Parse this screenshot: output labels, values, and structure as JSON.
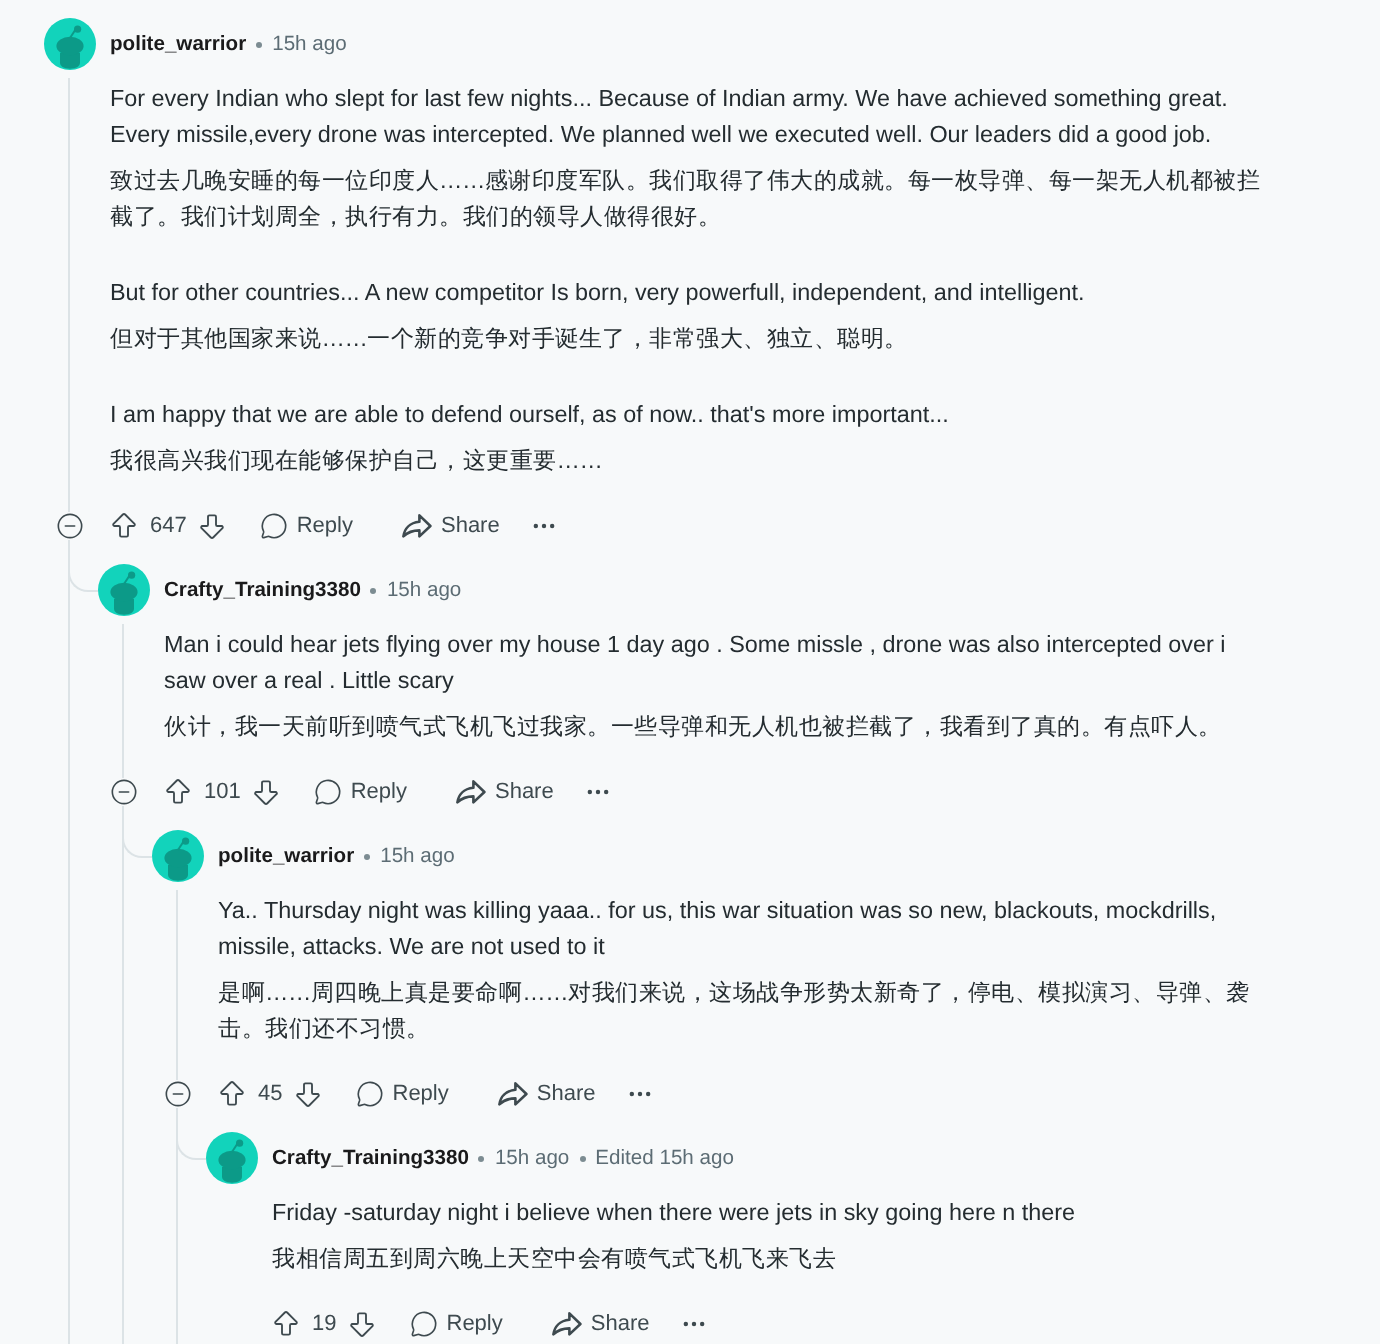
{
  "comments": [
    {
      "author": "polite_warrior",
      "time": "15h ago",
      "body": [
        {
          "paragraphs": [
            {
              "kind": "original",
              "text": "For every Indian who slept for last few nights... Because of Indian army. We have achieved something great. Every missile,every drone was intercepted. We planned well we executed well. Our leaders did a good job."
            },
            {
              "kind": "translated",
              "text": "致过去几晚安睡的每一位印度人……感谢印度军队。我们取得了伟大的成就。每一枚导弹、每一架无人机都被拦截了。我们计划周全，执行有力。我们的领导人做得很好。"
            }
          ]
        },
        {
          "paragraphs": [
            {
              "kind": "original",
              "text": "But for other countries... A new competitor Is born, very powerfull, independent, and intelligent."
            },
            {
              "kind": "translated",
              "text": "但对于其他国家来说……一个新的竞争对手诞生了，非常强大、独立、聪明。"
            }
          ]
        },
        {
          "paragraphs": [
            {
              "kind": "original",
              "text": "I am happy that we are able to defend ourself, as of now.. that's more important..."
            },
            {
              "kind": "translated",
              "text": "我很高兴我们现在能够保护自己，这更重要……"
            }
          ]
        }
      ],
      "votes": "647",
      "reply_label": "Reply",
      "share_label": "Share",
      "expanded": true,
      "replies": [
        {
          "author": "Crafty_Training3380",
          "time": "15h ago",
          "body": [
            {
              "paragraphs": [
                {
                  "kind": "original",
                  "text": "Man i could hear jets flying over my house 1 day ago . Some missle , drone was also intercepted over i saw over a real . Little scary"
                },
                {
                  "kind": "translated",
                  "text": "伙计，我一天前听到喷气式飞机飞过我家。一些导弹和无人机也被拦截了，我看到了真的。有点吓人。"
                }
              ]
            }
          ],
          "votes": "101",
          "reply_label": "Reply",
          "share_label": "Share",
          "expanded": true,
          "replies": [
            {
              "author": "polite_warrior",
              "time": "15h ago",
              "body": [
                {
                  "paragraphs": [
                    {
                      "kind": "original",
                      "text": "Ya.. Thursday night was killing yaaa.. for us, this war situation was so new, blackouts, mockdrills, missile, attacks. We are not used to it"
                    },
                    {
                      "kind": "translated",
                      "text": "是啊……周四晚上真是要命啊……对我们来说，这场战争形势太新奇了，停电、模拟演习、导弹、袭击。我们还不习惯。"
                    }
                  ]
                }
              ],
              "votes": "45",
              "reply_label": "Reply",
              "share_label": "Share",
              "expanded": true,
              "replies": [
                {
                  "author": "Crafty_Training3380",
                  "time": "15h ago",
                  "edited": "Edited 15h ago",
                  "body": [
                    {
                      "paragraphs": [
                        {
                          "kind": "original",
                          "text": "Friday -saturday night i believe when there were jets in sky going here n there"
                        },
                        {
                          "kind": "translated",
                          "text": "我相信周五到周六晚上天空中会有喷气式飞机飞来飞去"
                        }
                      ]
                    }
                  ],
                  "votes": "19",
                  "reply_label": "Reply",
                  "share_label": "Share"
                }
              ]
            }
          ]
        }
      ]
    }
  ]
}
